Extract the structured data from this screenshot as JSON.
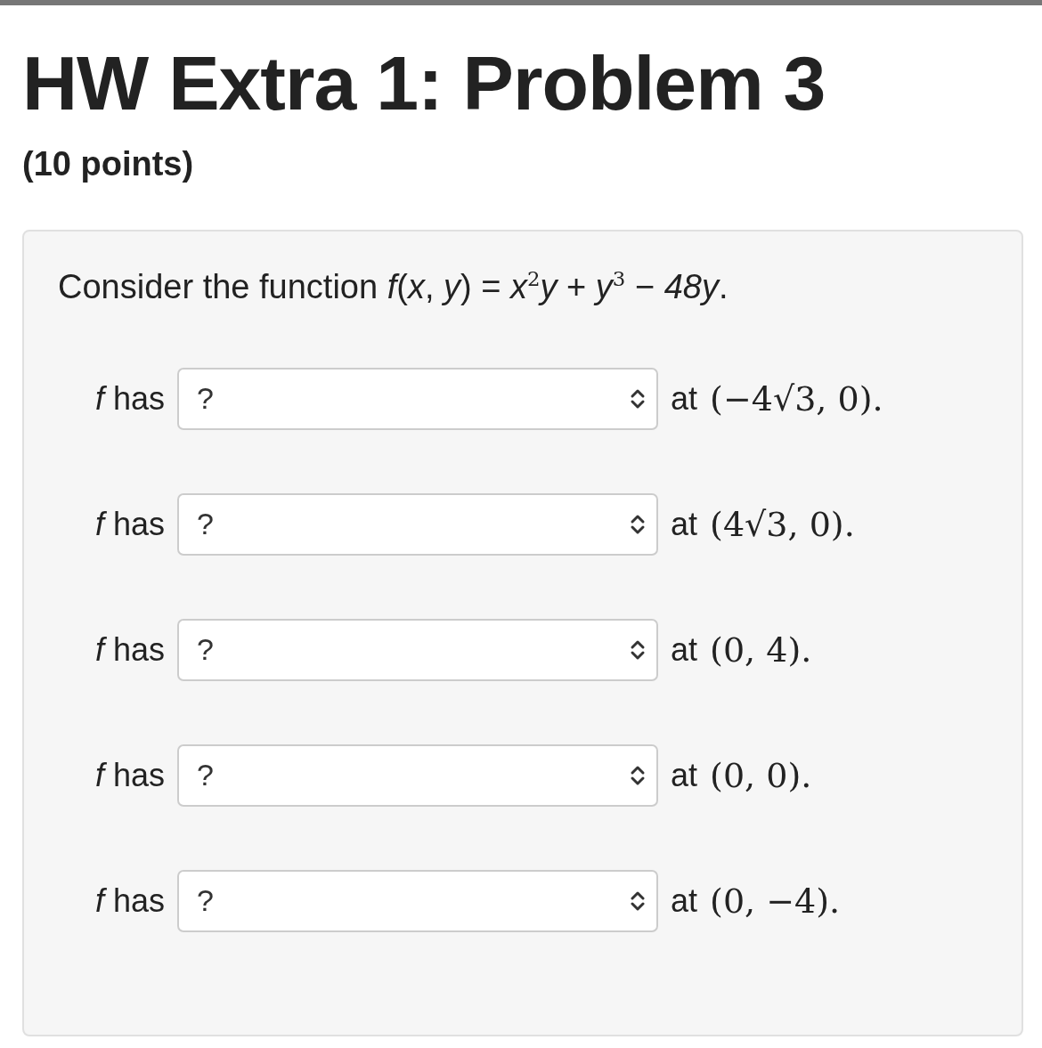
{
  "title": "HW Extra 1: Problem 3",
  "points": "(10 points)",
  "question": {
    "prompt": "Consider the function *f*(*x*, *y*) = *x*$^{2}$*y* + *y*$^{3}$ − *48y*.",
    "rows": [
      {
        "lead": "*f* has",
        "value": "?",
        "at": "at",
        "point": "(−4√3, 0)."
      },
      {
        "lead": "*f* has",
        "value": "?",
        "at": "at",
        "point": "(4√3, 0)."
      },
      {
        "lead": "*f* has",
        "value": "?",
        "at": "at",
        "point": "(0, 4)."
      },
      {
        "lead": "*f* has",
        "value": "?",
        "at": "at",
        "point": "(0, 0)."
      },
      {
        "lead": "*f* has",
        "value": "?",
        "at": "at",
        "point": "(0, −4)."
      }
    ]
  }
}
